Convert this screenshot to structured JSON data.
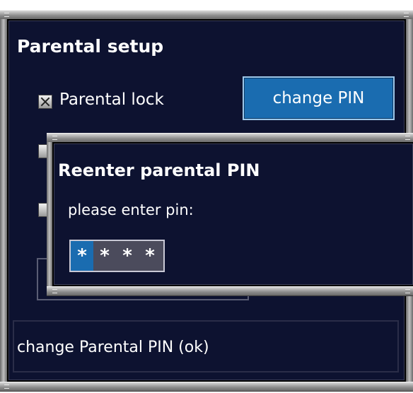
{
  "main_dialog": {
    "title": "Parental setup",
    "parental_lock_label": "Parental lock",
    "parental_lock_checked": true,
    "change_pin_button": "change PIN",
    "status_text": "change Parental PIN (ok)"
  },
  "pin_dialog": {
    "title": "Reenter parental PIN",
    "prompt": "please enter pin:",
    "pin_chars": [
      "*",
      "*",
      "*",
      "*"
    ],
    "active_index": 0
  },
  "colors": {
    "panel_bg": "#0d1230",
    "accent_blue": "#1a6cb0"
  }
}
